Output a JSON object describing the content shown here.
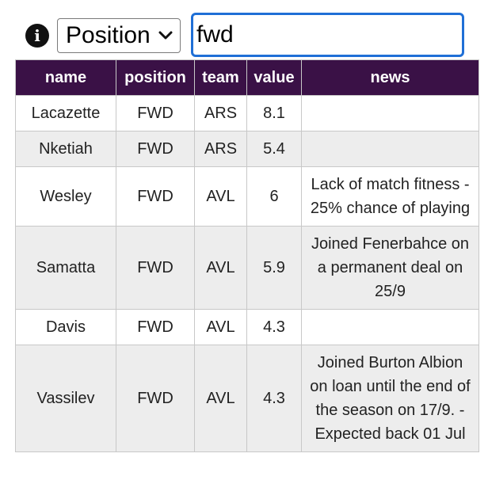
{
  "toolbar": {
    "info_icon_glyph": "i",
    "filter_select": {
      "selected": "Position"
    },
    "search": {
      "value": "fwd"
    }
  },
  "table": {
    "columns": [
      "name",
      "position",
      "team",
      "value",
      "news"
    ],
    "rows": [
      {
        "name": "Lacazette",
        "position": "FWD",
        "team": "ARS",
        "value": "8.1",
        "news": ""
      },
      {
        "name": "Nketiah",
        "position": "FWD",
        "team": "ARS",
        "value": "5.4",
        "news": ""
      },
      {
        "name": "Wesley",
        "position": "FWD",
        "team": "AVL",
        "value": "6",
        "news": "Lack of match fitness - 25% chance of playing"
      },
      {
        "name": "Samatta",
        "position": "FWD",
        "team": "AVL",
        "value": "5.9",
        "news": "Joined Fenerbahce on a permanent deal on 25/9"
      },
      {
        "name": "Davis",
        "position": "FWD",
        "team": "AVL",
        "value": "4.3",
        "news": ""
      },
      {
        "name": "Vassilev",
        "position": "FWD",
        "team": "AVL",
        "value": "4.3",
        "news": "Joined Burton Albion on loan until the end of the season on 17/9. - Expected back 01 Jul"
      }
    ]
  },
  "colors": {
    "header_bg": "#3a1146",
    "header_text": "#ffffff",
    "row_alt_bg": "#ededed",
    "focus_border": "#1f6fd6"
  }
}
